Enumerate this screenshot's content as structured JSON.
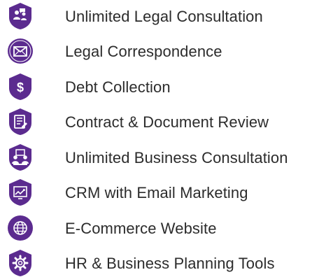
{
  "brand": {
    "accent": "#5b2b8f",
    "icon_fg": "#ffffff",
    "text_color": "#2c2c2c"
  },
  "features": [
    {
      "label": "Unlimited Legal Consultation",
      "icon": "consultation-icon"
    },
    {
      "label": "Legal Correspondence",
      "icon": "envelope-icon"
    },
    {
      "label": "Debt Collection",
      "icon": "dollar-icon"
    },
    {
      "label": "Contract & Document Review",
      "icon": "document-review-icon"
    },
    {
      "label": "Unlimited Business Consultation",
      "icon": "business-meeting-icon"
    },
    {
      "label": "CRM with Email Marketing",
      "icon": "crm-chart-icon"
    },
    {
      "label": "E-Commerce Website",
      "icon": "globe-icon"
    },
    {
      "label": "HR & Business Planning Tools",
      "icon": "gear-icon"
    }
  ]
}
